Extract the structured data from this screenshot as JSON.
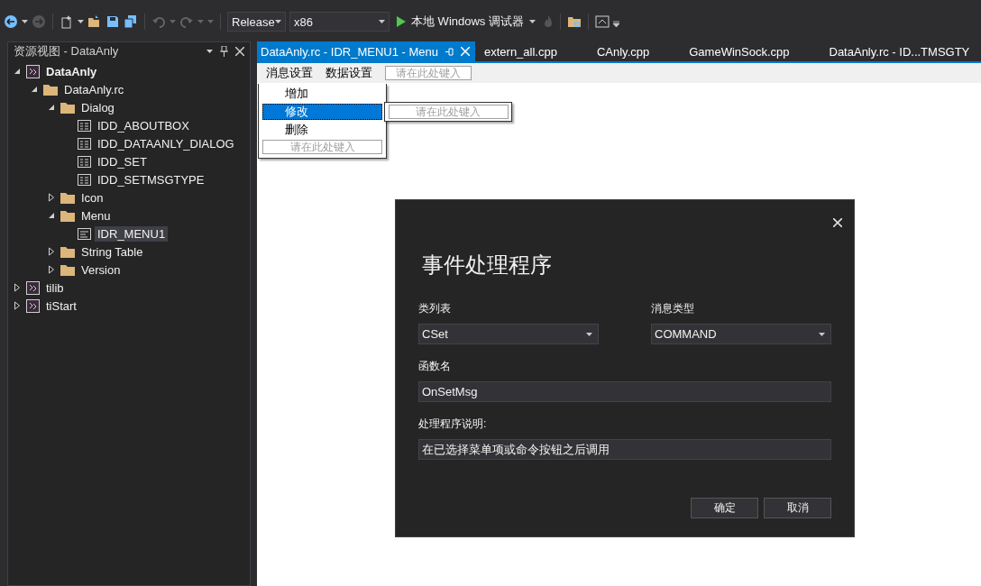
{
  "toolbar": {
    "configuration": "Release",
    "platform": "x86",
    "run_label": "本地 Windows 调试器"
  },
  "resource_view": {
    "title": "资源视图 - DataAnly",
    "tree": [
      {
        "label": "DataAnly",
        "kind": "startup_project",
        "expanded": true,
        "selected": false,
        "children": [
          {
            "label": "DataAnly.rc",
            "kind": "folder",
            "expanded": true,
            "selected": false,
            "children": [
              {
                "label": "Dialog",
                "kind": "folder",
                "expanded": true,
                "selected": false,
                "children": [
                  {
                    "label": "IDD_ABOUTBOX",
                    "kind": "dialog",
                    "selected": false
                  },
                  {
                    "label": "IDD_DATAANLY_DIALOG",
                    "kind": "dialog",
                    "selected": false
                  },
                  {
                    "label": "IDD_SET",
                    "kind": "dialog",
                    "selected": false
                  },
                  {
                    "label": "IDD_SETMSGTYPE",
                    "kind": "dialog",
                    "selected": false
                  }
                ]
              },
              {
                "label": "Icon",
                "kind": "folder",
                "expanded": false,
                "selected": false
              },
              {
                "label": "Menu",
                "kind": "folder",
                "expanded": true,
                "selected": false,
                "children": [
                  {
                    "label": "IDR_MENU1",
                    "kind": "menu",
                    "selected": true
                  }
                ]
              },
              {
                "label": "String Table",
                "kind": "folder",
                "expanded": false,
                "selected": false
              },
              {
                "label": "Version",
                "kind": "folder",
                "expanded": false,
                "selected": false
              }
            ]
          }
        ]
      },
      {
        "label": "tilib",
        "kind": "project",
        "expanded": false,
        "selected": false
      },
      {
        "label": "tiStart",
        "kind": "project",
        "expanded": false,
        "selected": false
      }
    ]
  },
  "tabs": [
    {
      "label": "DataAnly.rc - IDR_MENU1 - Menu",
      "selected": true
    },
    {
      "label": "extern_all.cpp",
      "selected": false
    },
    {
      "label": "CAnly.cpp",
      "selected": false
    },
    {
      "label": "GameWinSock.cpp",
      "selected": false
    },
    {
      "label": "DataAnly.rc - ID...TMSGTY",
      "selected": false
    }
  ],
  "menu_designer": {
    "menu_bar": [
      "消息设置",
      "数据设置"
    ],
    "bar_placeholder": "请在此处键入",
    "dropdown": [
      {
        "label": "增加",
        "selected": false
      },
      {
        "label": "修改",
        "selected": true
      },
      {
        "label": "删除",
        "selected": false
      }
    ],
    "dropdown_placeholder": "请在此处键入",
    "submenu_placeholder": "请在此处键入"
  },
  "dialog": {
    "title": "事件处理程序",
    "class_list": {
      "label": "类列表",
      "value": "CSet"
    },
    "message_type": {
      "label": "消息类型",
      "value": "COMMAND"
    },
    "function_name": {
      "label": "函数名",
      "value": "OnSetMsg"
    },
    "description": {
      "label": "处理程序说明:",
      "value": "在已选择菜单项或命令按钮之后调用"
    },
    "buttons": [
      "确定",
      "取消"
    ]
  }
}
